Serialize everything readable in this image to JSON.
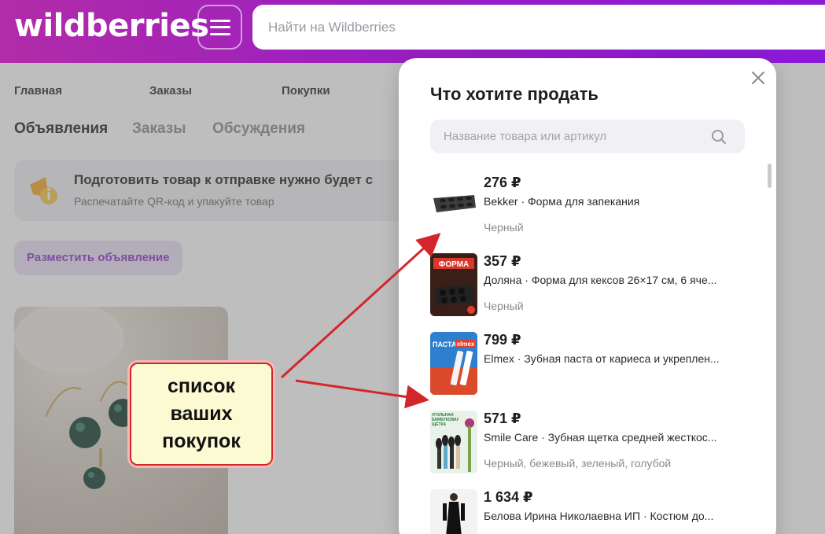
{
  "header": {
    "logo": "wildberries",
    "search_placeholder": "Найти на Wildberries"
  },
  "nav": [
    "Главная",
    "Заказы",
    "Покупки"
  ],
  "tabs": [
    "Объявления",
    "Заказы",
    "Обсуждения"
  ],
  "notice": {
    "title": "Подготовить товар к отправке нужно будет с",
    "subtitle": "Распечатайте QR-код и упакуйте товар"
  },
  "place_button": "Разместить объявление",
  "callout": {
    "text": "список\nваших\nпокупок"
  },
  "modal": {
    "title": "Что хотите продать",
    "search_placeholder": "Название товара или артикул",
    "items": [
      {
        "price": "276 ₽",
        "name": "Bekker · Форма для запекания",
        "color": "Черный"
      },
      {
        "price": "357 ₽",
        "name": "Доляна · Форма для кексов 26×17 см, 6 яче...",
        "color": "Черный",
        "thumb_text": "ФОРМА"
      },
      {
        "price": "799 ₽",
        "name": "Elmex · Зубная паста от кариеса и укреплен...",
        "color": "",
        "thumb_text": "ПАСТА",
        "thumb_brand": "elmex"
      },
      {
        "price": "571 ₽",
        "name": "Smile Care · Зубная щетка средней жесткос...",
        "color": "Черный, бежевый, зеленый, голубой",
        "thumb_text": "УГОЛЬНАЯ БАМБУКОВАЯ ЩЁТКА"
      },
      {
        "price": "1 634 ₽",
        "name": "Белова Ирина Николаевна ИП · Костюм до...",
        "color": ""
      }
    ]
  },
  "colors": {
    "brand": "#9b1fc0",
    "accent_button": "#8a34c6",
    "callout_border": "#d3262a",
    "arrow": "#d3262a"
  }
}
